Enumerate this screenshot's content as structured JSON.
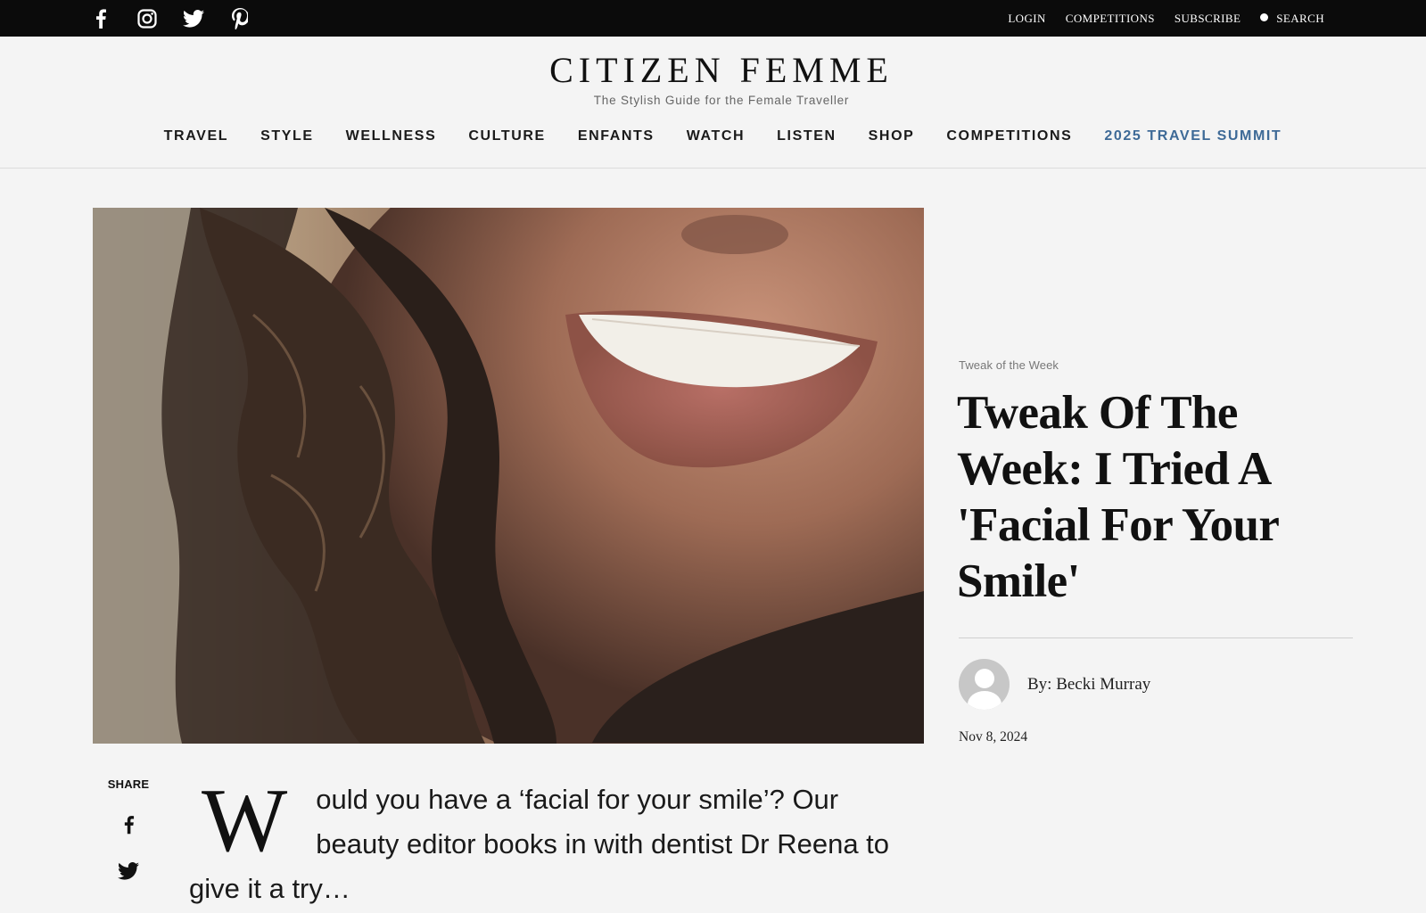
{
  "topbar": {
    "social": [
      {
        "icon": "facebook-icon"
      },
      {
        "icon": "instagram-icon"
      },
      {
        "icon": "twitter-icon"
      },
      {
        "icon": "pinterest-icon"
      }
    ],
    "links": {
      "login": "LOGIN",
      "competitions": "COMPETITIONS",
      "subscribe": "SUBSCRIBE",
      "search": "SEARCH"
    }
  },
  "brand": {
    "logo": "CITIZEN FEMME",
    "tagline": "The Stylish Guide for the Female Traveller"
  },
  "nav": {
    "items": [
      "TRAVEL",
      "STYLE",
      "WELLNESS",
      "CULTURE",
      "ENFANTS",
      "WATCH",
      "LISTEN",
      "SHOP",
      "COMPETITIONS",
      "2025 TRAVEL SUMMIT"
    ],
    "highlight_color": "#3e6a97"
  },
  "article": {
    "kicker": "Tweak of the Week",
    "title": "Tweak Of The Week: I Tried A 'Facial For Your Smile'",
    "author": "By: Becki Murray",
    "date": "Nov 8, 2024",
    "share_label": "SHARE",
    "dropcap": "W",
    "intro": "ould you have a ‘facial for your smile’? Our beauty editor books in with dentist Dr Reena to give it a try…"
  }
}
